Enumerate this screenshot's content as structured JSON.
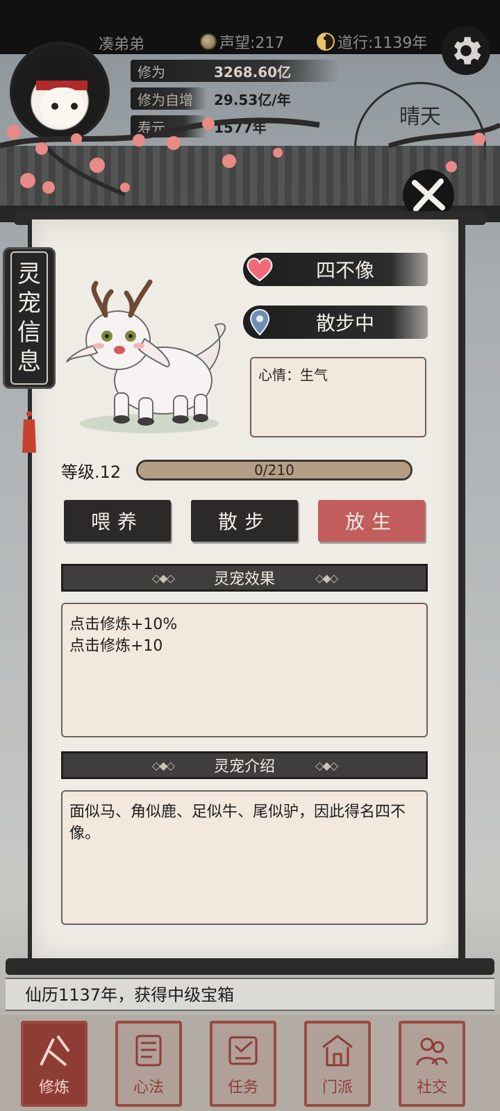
{
  "header": {
    "player_name": "凑弟弟",
    "reputation": "声望:217",
    "daoxing": "道行:1139年",
    "cultivation_label": "修为",
    "cultivation_value": "3268.60亿",
    "growth_label": "修为自增",
    "growth_value": "29.53亿/年",
    "lifespan_label": "寿元",
    "lifespan_value": "1577年",
    "weather": "晴天"
  },
  "side_tab": {
    "title_chars": [
      "灵",
      "宠",
      "信",
      "息"
    ]
  },
  "pet": {
    "name": "四不像",
    "status": "散步中",
    "mood": "心情：生气",
    "level": "等级.12",
    "xp_text": "0/210",
    "xp_progress": 1.0
  },
  "actions": {
    "feed": "喂养",
    "walk": "散步",
    "release": "放生"
  },
  "effects": {
    "title": "灵宠效果",
    "lines": [
      "点击修炼+10%",
      "点击修炼+10"
    ]
  },
  "intro": {
    "title": "灵宠介绍",
    "text": "面似马、角似鹿、足似牛、尾似驴，因此得名四不像。"
  },
  "log": {
    "text": "仙历1137年，获得中级宝箱"
  },
  "nav": {
    "items": [
      {
        "label": "修炼",
        "icon": "cultivate-icon"
      },
      {
        "label": "心法",
        "icon": "scroll-icon"
      },
      {
        "label": "任务",
        "icon": "task-icon"
      },
      {
        "label": "门派",
        "icon": "sect-icon"
      },
      {
        "label": "社交",
        "icon": "social-icon"
      }
    ]
  },
  "colors": {
    "accent_red": "#c25d5d",
    "panel_bg": "#efece6",
    "ink": "#2a2a2a"
  }
}
